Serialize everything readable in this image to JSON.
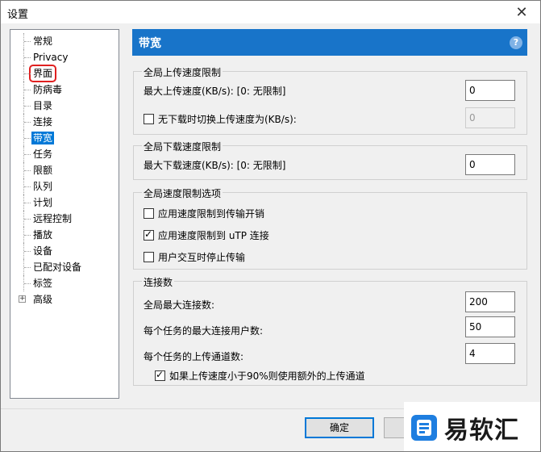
{
  "window": {
    "title": "设置",
    "close_glyph": "✕"
  },
  "tree": {
    "items": [
      {
        "label": "常规"
      },
      {
        "label": "Privacy"
      },
      {
        "label": "界面"
      },
      {
        "label": "防病毒"
      },
      {
        "label": "目录"
      },
      {
        "label": "连接"
      },
      {
        "label": "带宽"
      },
      {
        "label": "任务"
      },
      {
        "label": "限额"
      },
      {
        "label": "队列"
      },
      {
        "label": "计划"
      },
      {
        "label": "远程控制"
      },
      {
        "label": "播放"
      },
      {
        "label": "设备"
      },
      {
        "label": "已配对设备"
      },
      {
        "label": "标签"
      },
      {
        "label": "高级"
      }
    ],
    "selected": "带宽",
    "highlighted": "界面"
  },
  "panel": {
    "title": "带宽",
    "help_glyph": "?",
    "upload": {
      "group_title": "全局上传速度限制",
      "max_label": "最大上传速度(KB/s): [0: 无限制]",
      "max_value": "0",
      "alt_label": "无下载时切换上传速度为(KB/s):",
      "alt_checked": false,
      "alt_value": "0"
    },
    "download": {
      "group_title": "全局下载速度限制",
      "max_label": "最大下载速度(KB/s): [0: 无限制]",
      "max_value": "0"
    },
    "options": {
      "group_title": "全局速度限制选项",
      "opt1_label": "应用速度限制到传输开销",
      "opt1_checked": false,
      "opt2_label": "应用速度限制到 uTP 连接",
      "opt2_checked": true,
      "opt3_label": "用户交互时停止传输",
      "opt3_checked": false
    },
    "connections": {
      "group_title": "连接数",
      "global_label": "全局最大连接数:",
      "global_value": "200",
      "peers_label": "每个任务的最大连接用户数:",
      "peers_value": "50",
      "slots_label": "每个任务的上传通道数:",
      "slots_value": "4",
      "extra_label": "如果上传速度小于90%则使用额外的上传通道",
      "extra_checked": true
    }
  },
  "buttons": {
    "ok": "确定",
    "cancel": ""
  },
  "watermark": {
    "text": "易软汇",
    "accent": "#1e7ee0"
  }
}
